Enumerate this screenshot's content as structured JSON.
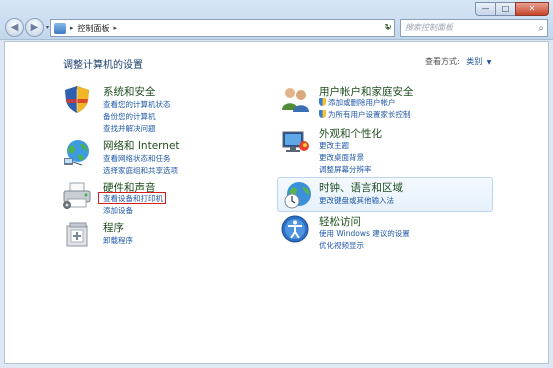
{
  "window": {
    "minimize_glyph": "—",
    "maximize_glyph": "□",
    "close_glyph": "✕"
  },
  "nav": {
    "back_glyph": "◀",
    "forward_glyph": "▶",
    "recent_glyph": "▾",
    "refresh_glyph": "↻"
  },
  "address": {
    "separator": "▸",
    "crumb": "控制面板",
    "dropdown_glyph": "▾"
  },
  "search": {
    "placeholder": "搜索控制面板",
    "icon_glyph": "⌕"
  },
  "main": {
    "title": "调整计算机的设置",
    "view_by_label": "查看方式:",
    "view_by_value": "类别",
    "view_by_arrow": "▼"
  },
  "categories": {
    "system_security": {
      "title": "系统和安全",
      "links": [
        "查看您的计算机状态",
        "备份您的计算机",
        "查找并解决问题"
      ]
    },
    "network": {
      "title": "网络和 Internet",
      "links": [
        "查看网络状态和任务",
        "选择家庭组和共享选项"
      ]
    },
    "hardware": {
      "title": "硬件和声音",
      "links": [
        "查看设备和打印机",
        "添加设备"
      ]
    },
    "programs": {
      "title": "程序",
      "links": [
        "卸载程序"
      ]
    },
    "user_accounts": {
      "title": "用户帐户和家庭安全",
      "links": [
        "添加或删除用户帐户",
        "为所有用户设置家长控制"
      ]
    },
    "appearance": {
      "title": "外观和个性化",
      "links": [
        "更改主题",
        "更改桌面背景",
        "调整屏幕分辨率"
      ]
    },
    "clock": {
      "title": "时钟、语言和区域",
      "links": [
        "更改键盘或其他输入法"
      ]
    },
    "ease": {
      "title": "轻松访问",
      "links": [
        "使用 Windows 建议的设置",
        "优化视频显示"
      ]
    }
  }
}
